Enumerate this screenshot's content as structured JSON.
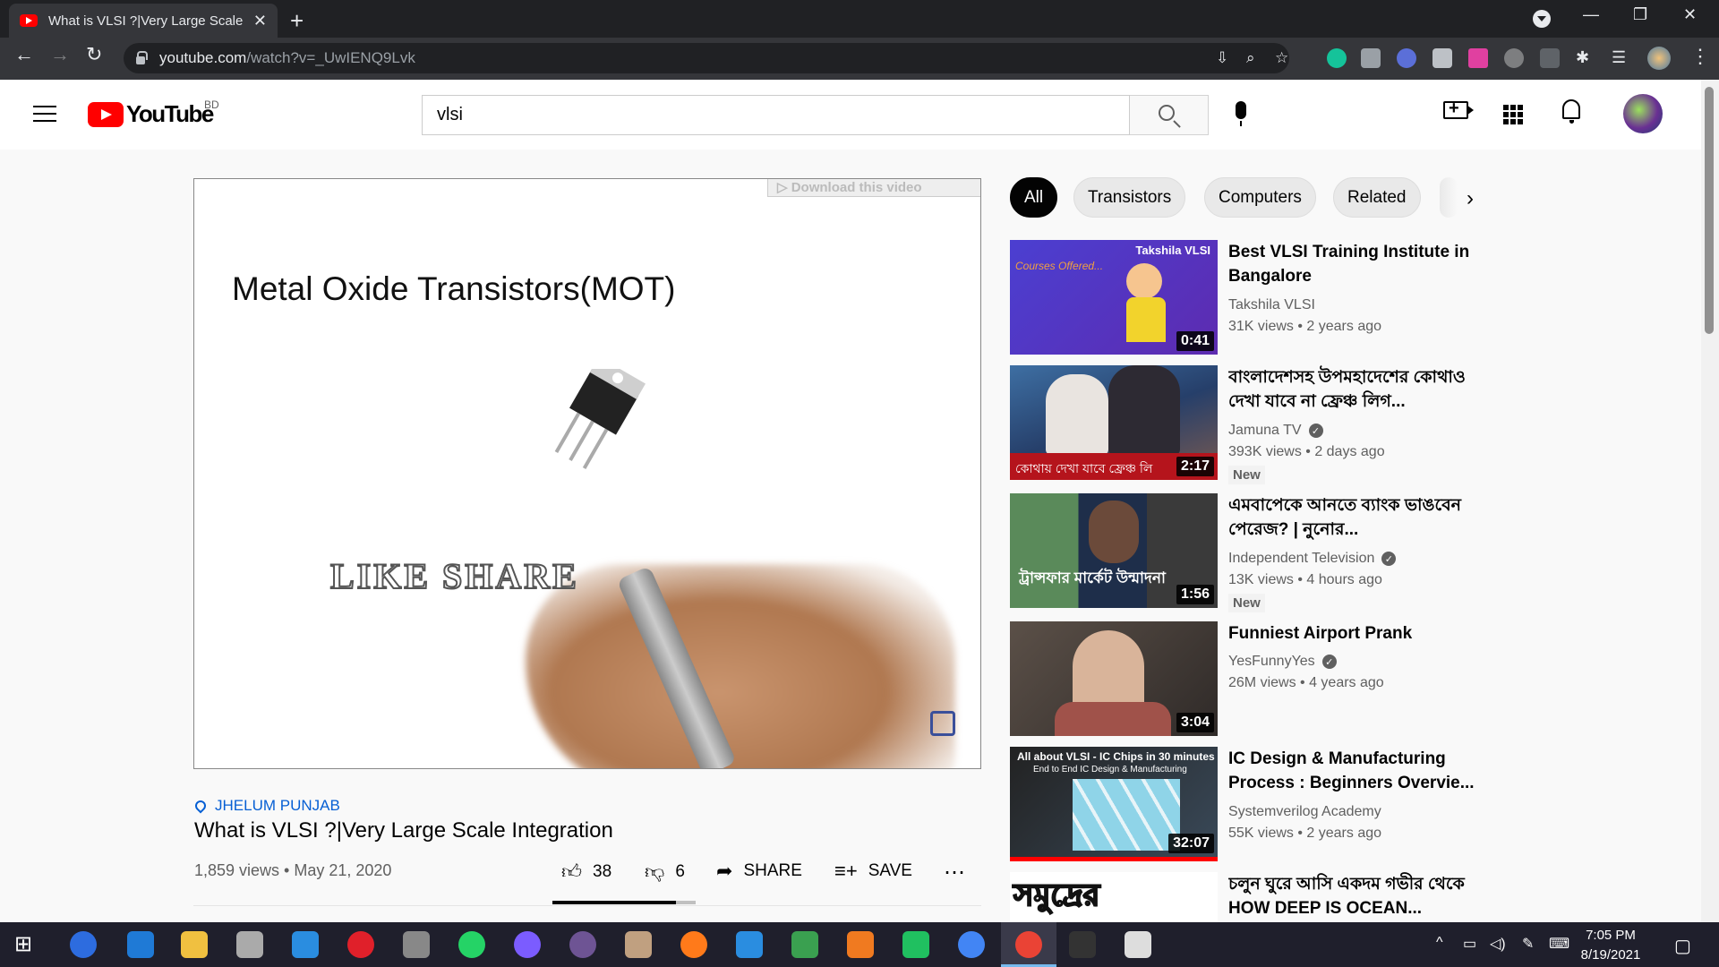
{
  "browser": {
    "tab_title": "What is VLSI ?|Very Large Scale Integration - YouTube",
    "url_host": "youtube.com",
    "url_path": "/watch?v=_UwIENQ9Lvk"
  },
  "header": {
    "logo_text": "YouTube",
    "country": "BD",
    "search_value": "vlsi"
  },
  "player": {
    "download_label": "▷ Download this video",
    "slide_title": "Metal Oxide Transistors(MOT)",
    "slide_text": "LIKE  SHARE"
  },
  "video": {
    "location": "JHELUM PUNJAB",
    "title": "What is VLSI ?|Very Large Scale Integration",
    "meta": "1,859 views • May 21, 2020",
    "likes": "38",
    "dislikes": "6",
    "share_label": "SHARE",
    "save_label": "SAVE",
    "like_ratio": 0.86
  },
  "chips": [
    "All",
    "Transistors",
    "Computers",
    "Related"
  ],
  "recommendations": [
    {
      "title": "Best VLSI Training Institute in Bangalore",
      "channel": "Takshila VLSI",
      "verified": false,
      "meta": "31K views • 2 years ago",
      "duration": "0:41",
      "badge": ""
    },
    {
      "title": "বাংলাদেশসহ উপমহাদেশের কোথাও দেখা যাবে না ফ্রেঞ্চ লিগ...",
      "channel": "Jamuna TV",
      "verified": true,
      "meta": "393K views • 2 days ago",
      "duration": "2:17",
      "badge": "New"
    },
    {
      "title": "এমবাপেকে আনতে ব্যাংক ভাঙবেন পেরেজ? | নুনোর...",
      "channel": "Independent Television",
      "verified": true,
      "meta": "13K views • 4 hours ago",
      "duration": "1:56",
      "badge": "New"
    },
    {
      "title": "Funniest Airport Prank",
      "channel": "YesFunnyYes",
      "verified": true,
      "meta": "26M views • 4 years ago",
      "duration": "3:04",
      "badge": ""
    },
    {
      "title": "IC Design & Manufacturing Process : Beginners Overvie...",
      "channel": "Systemverilog Academy",
      "verified": false,
      "meta": "55K views • 2 years ago",
      "duration": "32:07",
      "badge": ""
    },
    {
      "title": "চলুন ঘুরে আসি একদম গভীর থেকে HOW DEEP IS OCEAN...",
      "channel": "",
      "verified": false,
      "meta": "",
      "duration": "",
      "badge": ""
    }
  ],
  "thumb_text": {
    "takshila_brand": "Takshila VLSI",
    "takshila_courses": "Courses Offered...",
    "jamuna_caption": "কোথায় দেখা যাবে ফ্রেঞ্চ লি",
    "independent_caption": "ট্রান্সফার মার্কেট উন্মাদনা",
    "ic_caption": "All about VLSI - IC Chips in 30 minutes",
    "ic_sub": "End to End IC Design & Manufacturing",
    "ocean_caption": "সমুদ্রের"
  },
  "taskbar": {
    "time": "7:05 PM",
    "date": "8/19/2021"
  },
  "colors": {
    "yt_red": "#ff0000",
    "link_blue": "#065fd4",
    "chrome_dark": "#202124"
  }
}
